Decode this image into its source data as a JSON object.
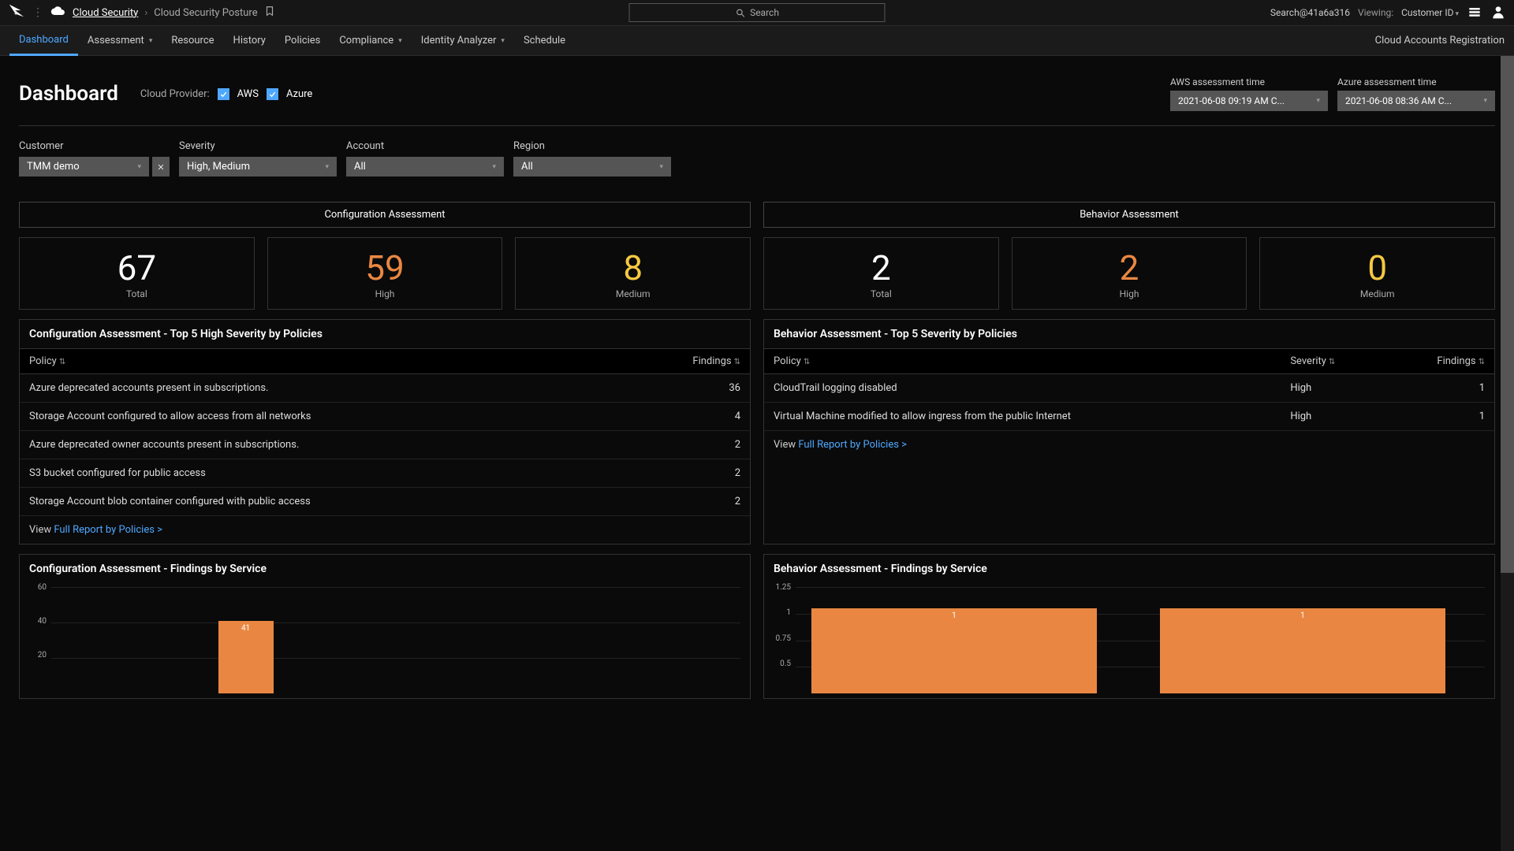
{
  "breadcrumb": {
    "root": "Cloud Security",
    "current": "Cloud Security Posture"
  },
  "search": {
    "placeholder": "Search"
  },
  "user_context": {
    "search_id": "Search@41a6a316",
    "viewing_label": "Viewing:",
    "viewing_value": "Customer ID"
  },
  "nav": {
    "items": [
      "Dashboard",
      "Assessment",
      "Resource",
      "History",
      "Policies",
      "Compliance",
      "Identity Analyzer",
      "Schedule"
    ],
    "right": "Cloud Accounts Registration"
  },
  "page": {
    "title": "Dashboard",
    "provider_label": "Cloud Provider:",
    "providers": [
      {
        "name": "AWS",
        "checked": true
      },
      {
        "name": "Azure",
        "checked": true
      }
    ],
    "times": [
      {
        "label": "AWS assessment time",
        "value": "2021-06-08 09:19 AM C..."
      },
      {
        "label": "Azure assessment time",
        "value": "2021-06-08 08:36 AM C..."
      }
    ]
  },
  "filters": {
    "customer": {
      "label": "Customer",
      "value": "TMM demo"
    },
    "severity": {
      "label": "Severity",
      "value": "High, Medium"
    },
    "account": {
      "label": "Account",
      "value": "All"
    },
    "region": {
      "label": "Region",
      "value": "All"
    }
  },
  "assess_tabs": {
    "config": "Configuration Assessment",
    "behavior": "Behavior Assessment"
  },
  "stats": {
    "config": {
      "total": "67",
      "high": "59",
      "medium": "8"
    },
    "behavior": {
      "total": "2",
      "high": "2",
      "medium": "0"
    },
    "labels": {
      "total": "Total",
      "high": "High",
      "medium": "Medium"
    }
  },
  "config_top5": {
    "title": "Configuration Assessment - Top 5 High Severity by Policies",
    "cols": {
      "policy": "Policy",
      "findings": "Findings"
    },
    "rows": [
      {
        "policy": "Azure deprecated accounts present in subscriptions.",
        "findings": "36"
      },
      {
        "policy": "Storage Account configured to allow access from all networks",
        "findings": "4"
      },
      {
        "policy": "Azure deprecated owner accounts present in subscriptions.",
        "findings": "2"
      },
      {
        "policy": "S3 bucket configured for public access",
        "findings": "2"
      },
      {
        "policy": "Storage Account blob container configured with public access",
        "findings": "2"
      }
    ],
    "view_pre": "View ",
    "view_link": "Full Report by Policies >"
  },
  "behavior_top5": {
    "title": "Behavior Assessment - Top 5 Severity by Policies",
    "cols": {
      "policy": "Policy",
      "severity": "Severity",
      "findings": "Findings"
    },
    "rows": [
      {
        "policy": "CloudTrail logging disabled",
        "severity": "High",
        "findings": "1"
      },
      {
        "policy": "Virtual Machine modified to allow ingress from the public Internet",
        "severity": "High",
        "findings": "1"
      }
    ],
    "view_pre": "View ",
    "view_link": "Full Report by Policies >"
  },
  "config_chart": {
    "title": "Configuration Assessment - Findings by Service"
  },
  "behavior_chart": {
    "title": "Behavior Assessment - Findings by Service"
  },
  "chart_data": [
    {
      "type": "bar",
      "title": "Configuration Assessment - Findings by Service",
      "ylim": [
        0,
        60
      ],
      "yticks": [
        20,
        40,
        60
      ],
      "series": [
        {
          "name": "Findings",
          "values": [
            41
          ]
        }
      ],
      "visible_bar": {
        "value": 41,
        "label": "41"
      },
      "colors": {
        "bar": "#e98742"
      }
    },
    {
      "type": "bar",
      "title": "Behavior Assessment - Findings by Service",
      "ylim": [
        0,
        1.25
      ],
      "yticks": [
        0.5,
        0.75,
        1,
        1.25
      ],
      "series": [
        {
          "name": "Findings",
          "values": [
            1,
            1
          ]
        }
      ],
      "bars": [
        {
          "value": 1,
          "label": "1"
        },
        {
          "value": 1,
          "label": "1"
        }
      ],
      "colors": {
        "bar": "#e98742"
      }
    }
  ]
}
